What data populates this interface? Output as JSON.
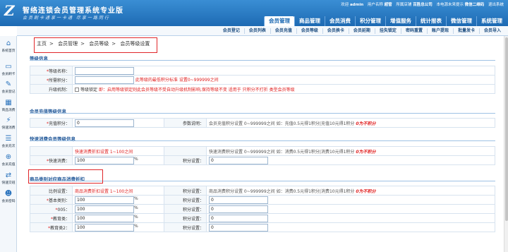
{
  "app": {
    "logo_mark": "Z",
    "title": "智络连锁会员管理系统专业版",
    "slogan": "会员刷卡通享一卡通 尽享一路同行"
  },
  "topinfo": {
    "welcome": "欢迎",
    "user": "admin",
    "usertype_label": "用户名称",
    "usertype": "超管",
    "shop_label": "所属店铺",
    "shop": "百胜总公司",
    "msg": "本电源未来提示",
    "wechat": "微信二维码",
    "logout": "退出系统"
  },
  "maintabs": [
    "会员管理",
    "商品管理",
    "会员消费",
    "积分管理",
    "增值服务",
    "统计报表",
    "微信管理",
    "系统管理"
  ],
  "subnav": [
    "会员登记",
    "会员列表",
    "会员充值",
    "会员等级",
    "会员换卡",
    "会员延期",
    "挂失锁定",
    "密码重置",
    "账户提现",
    "批量发卡",
    "会员导入"
  ],
  "sidebar": [
    {
      "icon": "⌂",
      "label": "系统首页"
    },
    {
      "icon": "▭",
      "label": "会员刷卡"
    },
    {
      "icon": "✎",
      "label": "会员登记"
    },
    {
      "icon": "▦",
      "label": "商品消费"
    },
    {
      "icon": "⚡",
      "label": "快速消费"
    },
    {
      "icon": "☰",
      "label": "会员充次"
    },
    {
      "icon": "⊕",
      "label": "会员充值"
    },
    {
      "icon": "⇄",
      "label": "快速交班"
    },
    {
      "icon": "☻",
      "label": "会员密码"
    }
  ],
  "breadcrumb": [
    "主页",
    "会员管理",
    "会员等级",
    "会员等级设置"
  ],
  "sections": {
    "level_info": "等级信息",
    "recharge_info": "会员充值等级信息",
    "quick_info": "快速消费会员等级信息",
    "goods_info": "商品类别对应商品消费折扣"
  },
  "level": {
    "name_label": "等级名称：",
    "points_label": "所需积分：",
    "points_hint": "此等级的最低积分标准 设置0~999999之间",
    "upgrade_label": "升级机制：",
    "upgrade_check": "等级锁定",
    "upgrade_hint": "即：启用等级锁定则此会员等级不受自动升级机制影响,保持等级不变 适用于 只积分不打折 类型会员等级"
  },
  "recharge": {
    "points_label": "充值积分：",
    "points_value": "0",
    "param_label": "参数说明：",
    "param_text": "会员充值积分设置 0~999999之间 如：充值0.5元得1积分|充值10元得1积分",
    "param_tail": "0为不积分"
  },
  "quick": {
    "discount_hint": "快速消费折扣设置 1~100之间",
    "points_text": "快速消费积分设置 0~999999之间 如：消费0.5元得1积分|消费10元得1积分",
    "points_tail": "0为不积分",
    "discount_label": "快速消费：",
    "discount_value": "100",
    "pct": "%",
    "points_label": "积分设置：",
    "points_value": "0"
  },
  "goods": {
    "ratio_label": "比例设置：",
    "discount_hint": "商品消费折扣设置 1~100之间",
    "points_head_label": "积分设置：",
    "points_text": "商品消费积分设置 0~999999之间 如：消费0.5元得1积分|消费10元得1积分",
    "points_tail": "0为不积分",
    "rows": [
      {
        "label": "基本类别：",
        "discount": "100",
        "points": "0"
      },
      {
        "label": "005：",
        "discount": "100",
        "points": "0"
      },
      {
        "label": "教育类：",
        "discount": "100",
        "points": "0"
      },
      {
        "label": "教育类2：",
        "discount": "100",
        "points": "0"
      }
    ],
    "points_label": "积分设置："
  },
  "colors": {
    "brand": "#1d6ab3",
    "highlight": "#e0262a"
  }
}
